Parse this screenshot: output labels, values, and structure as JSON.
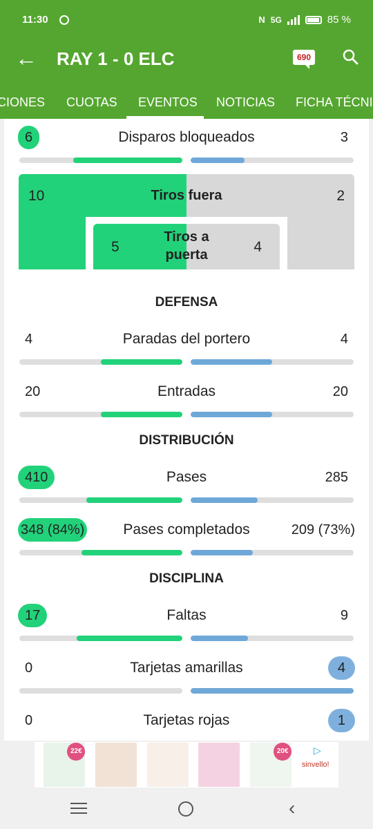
{
  "status_bar": {
    "time": "11:30",
    "network": "5G",
    "battery": "85 %"
  },
  "app_bar": {
    "title": "RAY 1 - 0 ELC",
    "comments_count": "690"
  },
  "tabs": [
    "CIONES",
    "CUOTAS",
    "EVENTOS",
    "NOTICIAS",
    "FICHA TÉCNIC"
  ],
  "active_tab": "EVENTOS",
  "stats_top": {
    "blocked": {
      "label": "Disparos bloqueados",
      "home": "6",
      "away": "3",
      "home_frac": 0.67,
      "away_frac": 0.33,
      "highlight": "home"
    }
  },
  "shots": {
    "off_label": "Tiros fuera",
    "off_home": "10",
    "off_away": "2",
    "on_label_1": "Tiros a",
    "on_label_2": "puerta",
    "on_home": "5",
    "on_away": "4"
  },
  "sections": {
    "defense": {
      "title": "DEFENSA",
      "rows": [
        {
          "label": "Paradas del portero",
          "home": "4",
          "away": "4",
          "home_frac": 0.5,
          "away_frac": 0.5,
          "highlight": "none"
        },
        {
          "label": "Entradas",
          "home": "20",
          "away": "20",
          "home_frac": 0.5,
          "away_frac": 0.5,
          "highlight": "none"
        }
      ]
    },
    "distribution": {
      "title": "DISTRIBUCIÓN",
      "rows": [
        {
          "label": "Pases",
          "home": "410",
          "away": "285",
          "home_frac": 0.59,
          "away_frac": 0.41,
          "highlight": "home"
        },
        {
          "label": "Pases completados",
          "home": "348 (84%)",
          "away": "209 (73%)",
          "home_frac": 0.62,
          "away_frac": 0.38,
          "highlight": "home"
        }
      ]
    },
    "discipline": {
      "title": "DISCIPLINA",
      "rows": [
        {
          "label": "Faltas",
          "home": "17",
          "away": "9",
          "home_frac": 0.65,
          "away_frac": 0.35,
          "highlight": "home"
        },
        {
          "label": "Tarjetas amarillas",
          "home": "0",
          "away": "4",
          "home_frac": 0.0,
          "away_frac": 1.0,
          "highlight": "away"
        },
        {
          "label": "Tarjetas rojas",
          "home": "0",
          "away": "1",
          "home_frac": 0.0,
          "away_frac": 1.0,
          "highlight": "away"
        }
      ]
    }
  },
  "ad": {
    "brand": "sinvello!",
    "badge_1": "22€",
    "badge_2": "20€"
  },
  "colors": {
    "brand_green": "#55a630",
    "home_green": "#22d27a",
    "away_blue": "#6fa8d8"
  }
}
